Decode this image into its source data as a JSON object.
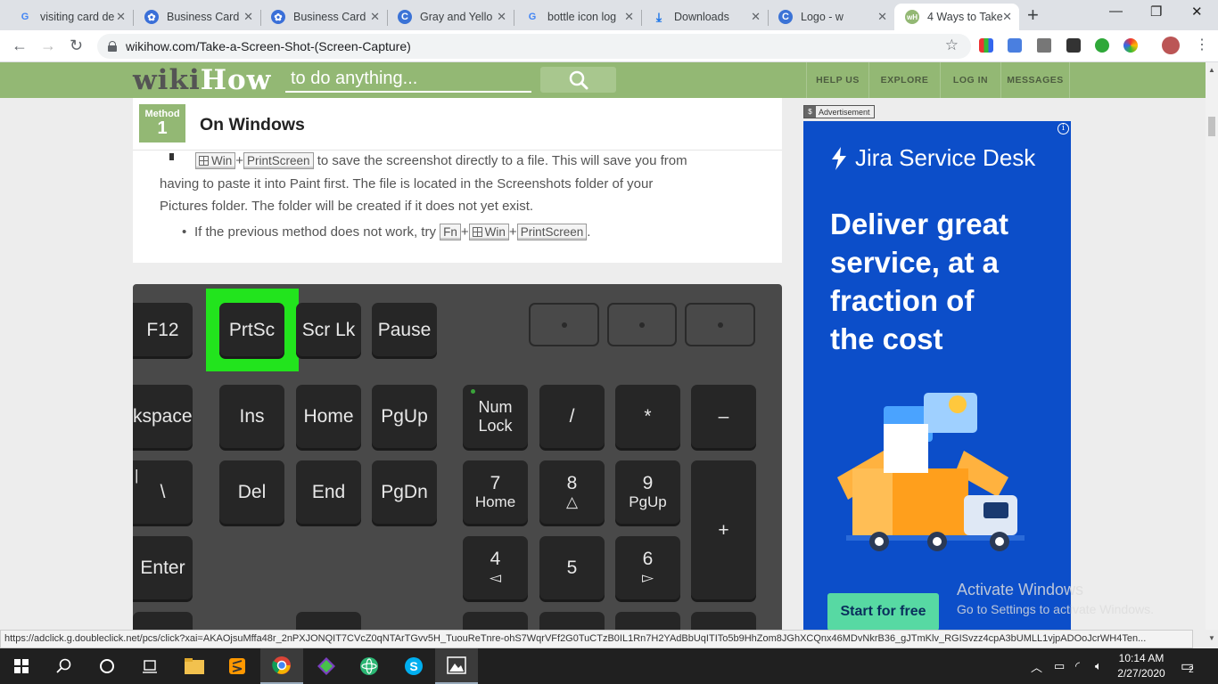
{
  "browser": {
    "tabs": [
      {
        "title": "visiting card de",
        "favicon": "google-icon",
        "active": false
      },
      {
        "title": "Business Card",
        "favicon": "gear-badge-icon",
        "active": false
      },
      {
        "title": "Business Card",
        "favicon": "gear-badge-icon",
        "active": false
      },
      {
        "title": "Gray and Yello",
        "favicon": "canva-icon",
        "active": false
      },
      {
        "title": "bottle icon log",
        "favicon": "google-icon",
        "active": false
      },
      {
        "title": "Downloads",
        "favicon": "download-icon",
        "active": false
      },
      {
        "title": "Logo - w",
        "favicon": "canva-icon",
        "active": false
      },
      {
        "title": "4 Ways to Take",
        "favicon": "wikihow-icon",
        "active": true
      }
    ],
    "new_tab": "+",
    "url": "wikihow.com/Take-a-Screen-Shot-(Screen-Capture)",
    "status_url": "https://adclick.g.doubleclick.net/pcs/click?xai=AKAOjsuMffa48r_2nPXJONQIT7CVcZ0qNTArTGvv5H_TuouReTnre-ohS7WqrVFf2G0TuCTzB0IL1Rn7H2YAdBbUqITITo5b9HhZom8JGhXCQnx46MDvNkrB36_gJTmKlv_RGISvzz4cpA3bUMLL1vjpADOoJcrWH4Ten..."
  },
  "wikihow": {
    "logo_part1": "wiki",
    "logo_part2": "How",
    "search_placeholder": "to do anything...",
    "nav": [
      "HELP US",
      "EXPLORE",
      "LOG IN",
      "MESSAGES"
    ]
  },
  "article": {
    "method_label": "Method",
    "method_number": "1",
    "method_title": "On Windows",
    "keys": {
      "win": "Win",
      "printscreen": "PrintScreen",
      "fn": "Fn",
      "plus": "+"
    },
    "para_rest_line1": " to save the screenshot directly to a file. This will save you from",
    "para_line2": "having to paste it into Paint first. The file is located in the Screenshots folder of your",
    "para_line3": "Pictures folder. The folder will be created if it does not yet exist.",
    "bullet_prefix": "If the previous method does not work, try ",
    "bullet_suffix": "."
  },
  "keyboard_image": {
    "keys": {
      "f12": "F12",
      "prtsc": "PrtSc",
      "scrlk": "Scr Lk",
      "pause": "Pause",
      "backspace": "kspace",
      "ins": "Ins",
      "home": "Home",
      "pgup": "PgUp",
      "numlock1": "Num",
      "numlock2": "Lock",
      "slash": "/",
      "star": "*",
      "minus": "–",
      "backslash_top": "|",
      "backslash": "\\",
      "del": "Del",
      "end": "End",
      "pgdn": "PgDn",
      "n7": "7",
      "n7sub": "Home",
      "n8": "8",
      "n8sub": "△",
      "n9": "9",
      "n9sub": "PgUp",
      "plus": "+",
      "enter": "Enter",
      "n4": "4",
      "n4sub": "◅",
      "n5": "5",
      "n6": "6",
      "n6sub": "▻"
    },
    "highlight_color": "#22e41d"
  },
  "ad": {
    "label": "Advertisement",
    "brand": "Jira Service Desk",
    "headline": [
      "Deliver great",
      "service, at a",
      "fraction of",
      "the cost"
    ],
    "cta": "Start for free"
  },
  "watermark": {
    "line1": "Activate Windows",
    "line2": "Go to Settings to activate Windows."
  },
  "taskbar": {
    "time": "10:14 AM",
    "date": "2/27/2020",
    "notifications": "2"
  },
  "colors": {
    "wikihow_green": "#93b874",
    "ad_blue": "#0c4ec9",
    "ad_cta": "#57d9a3"
  }
}
